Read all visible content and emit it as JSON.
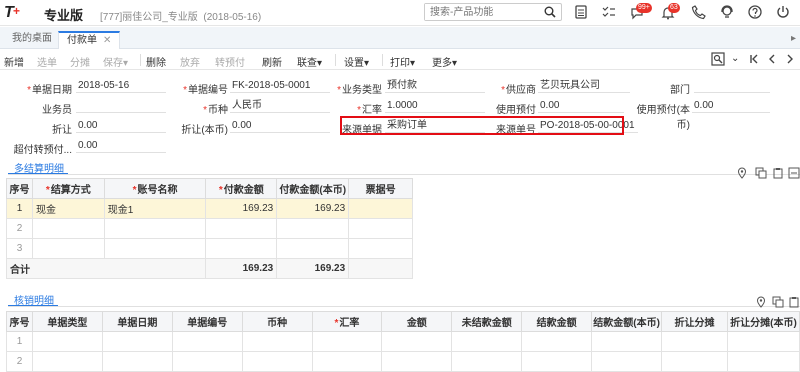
{
  "app": {
    "logo": "T",
    "edition": "专业版",
    "company": "[777]丽佳公司_专业版",
    "date": "(2018-05-16)"
  },
  "search": {
    "placeholder": "搜索-产品功能"
  },
  "badges": {
    "messages": "99+",
    "notices": "63"
  },
  "tabs": [
    {
      "label": "我的桌面"
    },
    {
      "label": "付款单"
    }
  ],
  "toolbar": {
    "new": "新增",
    "pick": "选单",
    "split": "分摊",
    "save": "保存▾",
    "delete": "删除",
    "discard": "放弃",
    "transfer": "转预付",
    "refresh": "刷新",
    "linked": "联查▾",
    "settings": "设置▾",
    "print": "打印▾",
    "more": "更多▾"
  },
  "form": {
    "doc_date_label": "单据日期",
    "doc_date": "2018-05-16",
    "doc_no_label": "单据编号",
    "doc_no": "FK-2018-05-0001",
    "biz_type_label": "业务类型",
    "biz_type": "预付款",
    "supplier_label": "供应商",
    "supplier": "艺贝玩具公司",
    "dept_label": "部门",
    "dept": "",
    "salesman_label": "业务员",
    "salesman": "",
    "currency_label": "币种",
    "currency": "人民币",
    "rate_label": "汇率",
    "rate": "1.0000",
    "use_prepay_label": "使用预付",
    "use_prepay": "0.00",
    "use_prepay_local_label": "使用预付(本币)",
    "use_prepay_local": "0.00",
    "discount_label": "折让",
    "discount": "0.00",
    "discount_local_label": "折让(本币)",
    "discount_local": "0.00",
    "source_doc_label": "来源单据",
    "source_doc": "采购订单",
    "source_no_label": "来源单号",
    "source_no": "PO-2018-05-00-0001",
    "over_prepay_label": "超付转预付...",
    "over_prepay": "0.00"
  },
  "settle": {
    "title": "多结算明细",
    "headers": [
      "序号",
      "结算方式",
      "账号名称",
      "付款金额",
      "付款金额(本币)",
      "票据号"
    ],
    "rows": [
      [
        "1",
        "现金",
        "现金1",
        "169.23",
        "169.23",
        ""
      ],
      [
        "2",
        "",
        "",
        "",
        "",
        ""
      ],
      [
        "3",
        "",
        "",
        "",
        "",
        ""
      ]
    ],
    "total_label": "合计",
    "total_amount": "169.23",
    "total_local": "169.23"
  },
  "writeoff": {
    "title": "核销明细",
    "headers": [
      "序号",
      "单据类型",
      "单据日期",
      "单据编号",
      "币种",
      "汇率",
      "金额",
      "未结款金额",
      "结款金额",
      "结款金额(本币)",
      "折让分摊",
      "折让分摊(本币)"
    ],
    "rows": [
      [
        "1"
      ],
      [
        "2"
      ]
    ]
  }
}
